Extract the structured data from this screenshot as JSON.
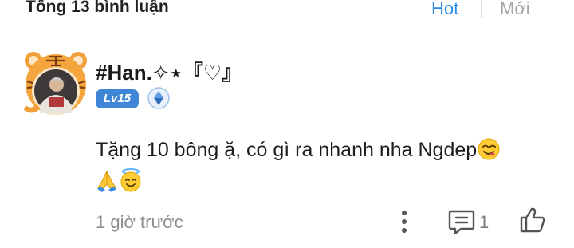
{
  "header": {
    "title": "Tổng 13 bình luận",
    "sort_hot": "Hot",
    "sort_new": "Mới",
    "accent_color": "#2e8ce6"
  },
  "comment": {
    "username": "#Han.✧⋆『♡』",
    "level": "Lv15",
    "text": "Tặng 10 bông ặ, có gì ra nhanh nha Ngdep",
    "emojis": [
      "face-savoring-food",
      "folded-hands",
      "smiling-face-with-halo"
    ],
    "time": "1 giờ trước",
    "reply_count": "1",
    "icons": [
      "avatar-tiger",
      "rank-badge-icon",
      "more-vertical-icon",
      "reply-icon",
      "like-icon"
    ]
  }
}
